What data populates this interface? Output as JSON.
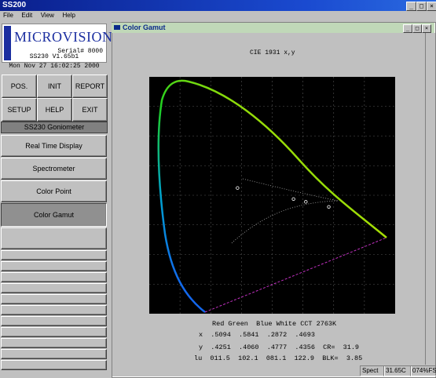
{
  "app": {
    "title": "SS200"
  },
  "menu": [
    {
      "label": "File"
    },
    {
      "label": "Edit"
    },
    {
      "label": "View"
    },
    {
      "label": "Help"
    }
  ],
  "brand": {
    "name": "MICROVISION",
    "serial": "Serial# 8000",
    "version": "SS230 V1.65b1",
    "datetime": "Mon Nov 27 16:02:25 2000"
  },
  "top_buttons": [
    {
      "label": "POS."
    },
    {
      "label": "INIT"
    },
    {
      "label": "REPORT"
    },
    {
      "label": "SETUP"
    },
    {
      "label": "HELP"
    },
    {
      "label": "EXIT"
    }
  ],
  "nav": {
    "header": "SS230 Goniometer",
    "items": [
      {
        "label": "Real Time Display"
      },
      {
        "label": "Spectrometer"
      },
      {
        "label": "Color Point"
      },
      {
        "label": "Color Gamut"
      }
    ],
    "selected": "Color Gamut"
  },
  "gamut_window": {
    "title": "Color Gamut",
    "chart_title": "CIE 1931 x,y",
    "table": {
      "header": "Red Green  Blue White CCT 2763K",
      "row_x": "x  .5094  .5841  .2872  .4693",
      "row_y": "y  .4251  .4060  .4777  .4356  CR=  31.9",
      "row_lu": "lu  011.5  102.1  081.1  122.9  BLK=  3.85"
    }
  },
  "chart_data": {
    "type": "scatter",
    "title": "CIE 1931 x,y",
    "series": [
      {
        "values": [
          [
            0.5094,
            0.4251
          ],
          [
            0.5841,
            0.406
          ],
          [
            0.2872,
            0.4777
          ],
          [
            0.4693,
            0.4356
          ]
        ]
      }
    ],
    "grid": true
  },
  "status": {
    "spect": "Spect",
    "temp": "31.65C",
    "pct": "074%FS"
  }
}
